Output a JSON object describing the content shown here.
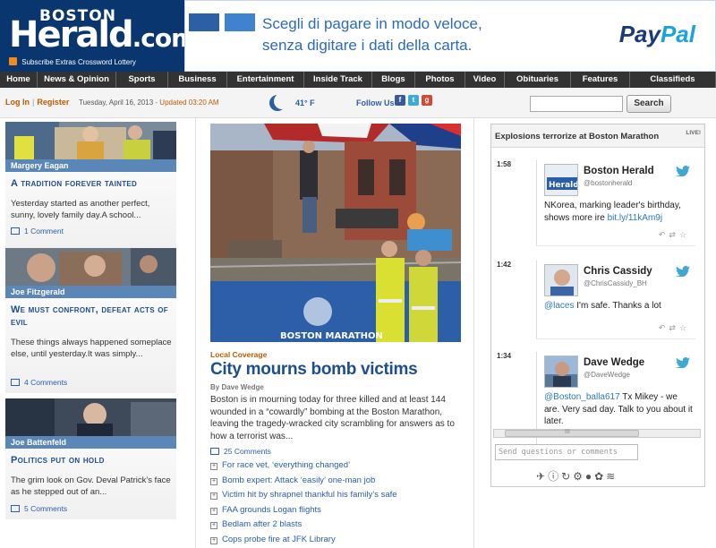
{
  "logo": {
    "top": "BOSTON",
    "main": "Herald",
    "suffix": ".com"
  },
  "logo_links": [
    "Subscribe",
    "Extras",
    "Crossword",
    "Lottery"
  ],
  "ad": {
    "line1": "Scegli di pagare in modo veloce,",
    "line2": "senza digitare i dati della carta.",
    "brand_a": "Pay",
    "brand_b": "Pal"
  },
  "nav": [
    {
      "label": "Home",
      "w": 42
    },
    {
      "label": "News & Opinion",
      "w": 88
    },
    {
      "label": "Sports",
      "w": 58
    },
    {
      "label": "Business",
      "w": 66
    },
    {
      "label": "Entertainment",
      "w": 86
    },
    {
      "label": "Inside Track",
      "w": 76
    },
    {
      "label": "Blogs",
      "w": 48
    },
    {
      "label": "Photos",
      "w": 56
    },
    {
      "label": "Video",
      "w": 44
    },
    {
      "label": "Obituaries",
      "w": 74
    },
    {
      "label": "Features",
      "w": 66
    },
    {
      "label": "Classifieds",
      "w": 96
    }
  ],
  "subbar": {
    "login": "Log In",
    "register": "Register",
    "date": "Tuesday, April 16, 2013",
    "updated": "- Updated 03:20 AM",
    "temp": "41° F",
    "follow": "Follow Us",
    "search_button": "Search"
  },
  "left_stories": [
    {
      "author": "Margery Eagan",
      "headline": "A tradition forever tainted",
      "text": "Yesterday started as another perfect, sunny, lovely family day.A school...",
      "comments": "1 Comment"
    },
    {
      "author": "Joe Fitzgerald",
      "headline": "We must confront, defeat acts of evil",
      "text": "These things always happened someplace else, until yesterday.It was simply...",
      "comments": "4 Comments"
    },
    {
      "author": "Joe Battenfeld",
      "headline": "Politics put on hold",
      "text": "The grim look on Gov. Deval Patrick’s face as he stepped out of an...",
      "comments": "5 Comments"
    }
  ],
  "main_story": {
    "kicker": "Local Coverage",
    "headline": "City mourns bomb victims",
    "byline": "By Dave Wedge",
    "text": "Boston is in mourning today for three killed and at least 144 wounded in a “cowardly” bombing at the Boston Marathon, leaving the tragedy-wracked city scrambling for answers as to how a terrorist was...",
    "comments": "25 Comments",
    "banner_text": "BOSTON MARATHON",
    "related": [
      "For race vet, ‘everything changed’",
      "Bomb expert: Attack ‘easily’ one-man job",
      "Victim hit by shrapnel thankful his family’s safe",
      "FAA grounds Logan flights",
      "Bedlam after 2 blasts",
      "Cops probe fire at JFK Library"
    ]
  },
  "live": {
    "title": "Explosions terrorize at Boston Marathon",
    "badge": "LIVE!",
    "entries": [
      {
        "time": "1:58",
        "name": "Boston Herald",
        "handle": "@bostonherald",
        "text": "NKorea, marking leader's birthday, shows more ire ",
        "link": "bit.ly/11kAm9j",
        "mention": ""
      },
      {
        "time": "1:42",
        "name": "Chris Cassidy",
        "handle": "@ChrisCassidy_BH",
        "text": " I'm safe. Thanks a lot",
        "link": "",
        "mention": "@laces"
      },
      {
        "time": "1:34",
        "name": "Dave Wedge",
        "handle": "@DaveWedge",
        "text": " Tx Mikey - we are. Very sad day. Talk to you about it later.",
        "link": "",
        "mention": "@Boston_balla617"
      }
    ],
    "ask_placeholder": "Send questions or comments",
    "scroll_grip": "III"
  },
  "colors": {
    "brand_blue": "#0a3670",
    "link_blue": "#2a5ea8",
    "accent_orange": "#c25a00",
    "byline_bar": "#5b86b8"
  }
}
